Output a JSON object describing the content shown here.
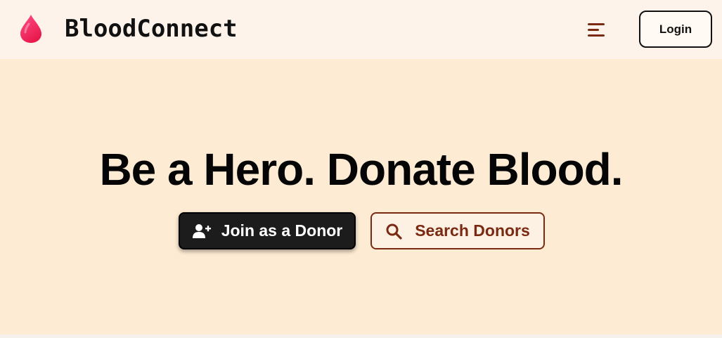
{
  "header": {
    "brand_name": "BloodConnect",
    "brand_icon": "blood-drop-icon",
    "menu_icon": "menu-icon",
    "login_label": "Login"
  },
  "hero": {
    "title": "Be a Hero. Donate Blood.",
    "primary_button": {
      "label": "Join as a Donor",
      "icon": "add-user-icon"
    },
    "secondary_button": {
      "label": "Search Donors",
      "icon": "search-icon"
    }
  },
  "colors": {
    "page_background": "#fdebd3",
    "navbar_background": "#fdf3ea",
    "brand_drop": "#f0285a",
    "accent_brown": "#7a2a12",
    "primary_button": "#1c1c1c"
  }
}
